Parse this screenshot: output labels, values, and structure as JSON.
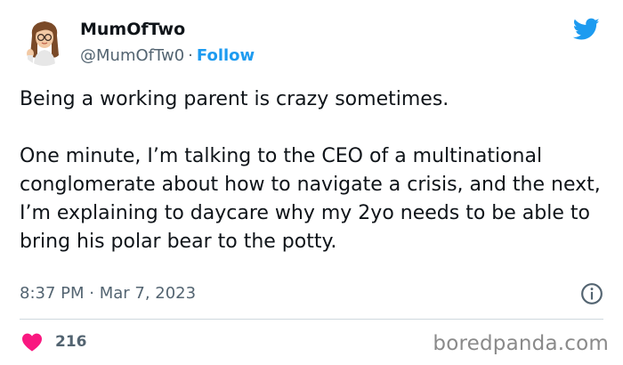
{
  "author": {
    "display_name": "MumOfTwo",
    "handle": "@MumOfTw0",
    "separator": "·",
    "follow_label": "Follow",
    "avatar_icon": "bitmoji-avatar"
  },
  "tweet": {
    "text": "Being a working parent is crazy sometimes.\n\nOne minute, I’m talking to the CEO of a multinational conglomerate about how to navigate a crisis, and the next, I’m explaining to daycare why my 2yo needs to be able to bring his polar bear to the potty.",
    "timestamp": "8:37 PM · Mar 7, 2023"
  },
  "engagement": {
    "like_count": "216",
    "like_icon": "heart-icon"
  },
  "icons": {
    "brand": "twitter-bird-icon",
    "info": "info-icon"
  },
  "watermark": "boredpanda.com",
  "colors": {
    "twitter_blue": "#1d9bf0",
    "secondary_text": "#536471",
    "heart_pink": "#f91880",
    "primary_text": "#0f1419"
  }
}
